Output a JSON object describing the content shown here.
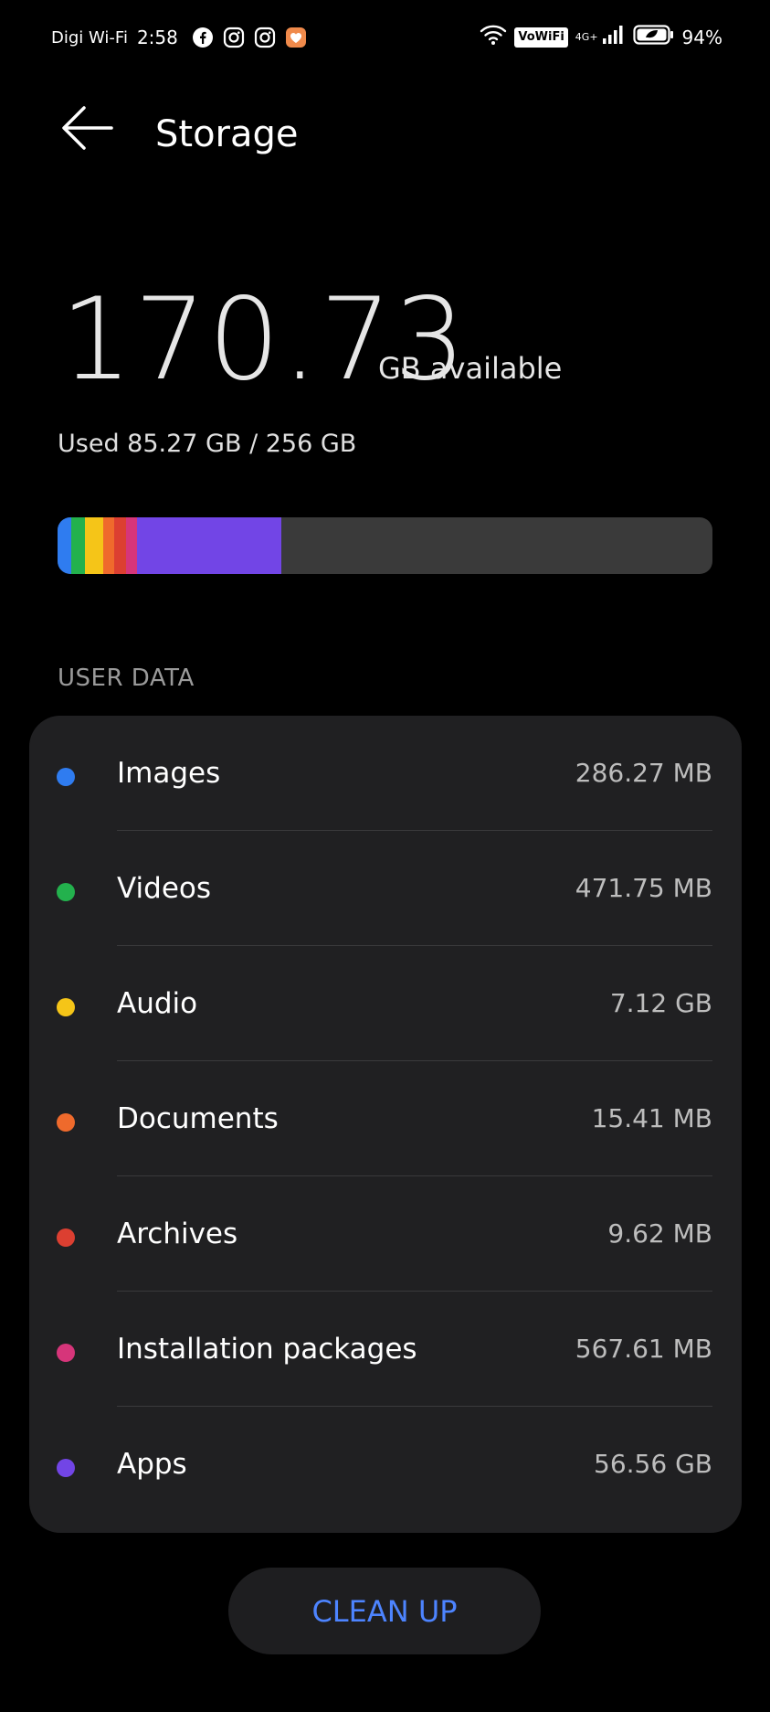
{
  "status_bar": {
    "carrier": "Digi Wi-Fi",
    "time": "2:58",
    "vowifi": "VoWiFi",
    "network": "4G+",
    "battery": "94%",
    "notification_icons": [
      "facebook-icon",
      "instagram-icon",
      "instagram-icon",
      "heart-app-icon"
    ]
  },
  "header": {
    "title": "Storage"
  },
  "summary": {
    "available_value": "170.73",
    "available_unit": "GB available",
    "used_text": "Used 85.27 GB / 256 GB"
  },
  "usage_bar": {
    "segments": [
      {
        "name": "Images",
        "color": "#2f7cf0",
        "fraction": 0.021
      },
      {
        "name": "Videos",
        "color": "#23b14d",
        "fraction": 0.021
      },
      {
        "name": "Audio",
        "color": "#f5c518",
        "fraction": 0.028
      },
      {
        "name": "Documents",
        "color": "#ef6a2c",
        "fraction": 0.017
      },
      {
        "name": "Archives",
        "color": "#dc3f31",
        "fraction": 0.017
      },
      {
        "name": "Installation packages",
        "color": "#d6357a",
        "fraction": 0.017
      },
      {
        "name": "Apps",
        "color": "#7245e6",
        "fraction": 0.221
      }
    ],
    "track_color": "#3a3a3a"
  },
  "section": {
    "label": "USER DATA"
  },
  "categories": [
    {
      "label": "Images",
      "size": "286.27 MB",
      "color": "#2f7cf0"
    },
    {
      "label": "Videos",
      "size": "471.75 MB",
      "color": "#23b14d"
    },
    {
      "label": "Audio",
      "size": "7.12 GB",
      "color": "#f5c518"
    },
    {
      "label": "Documents",
      "size": "15.41 MB",
      "color": "#ef6a2c"
    },
    {
      "label": "Archives",
      "size": "9.62 MB",
      "color": "#dc3f31"
    },
    {
      "label": "Installation packages",
      "size": "567.61 MB",
      "color": "#d6357a"
    },
    {
      "label": "Apps",
      "size": "56.56 GB",
      "color": "#7245e6"
    }
  ],
  "actions": {
    "clean_up": "CLEAN UP"
  },
  "colors": {
    "background": "#000000",
    "card": "#202022",
    "accent": "#4d84ff"
  }
}
